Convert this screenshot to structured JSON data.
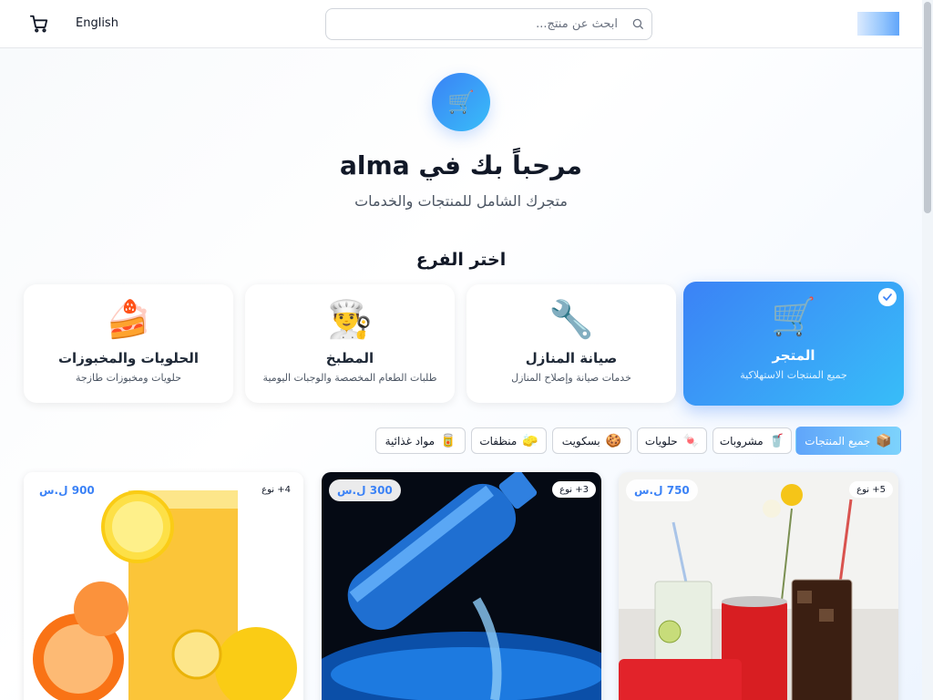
{
  "header": {
    "language_label": "English",
    "search_placeholder": "ابحث عن منتج...",
    "icons": {
      "cart": "cart-icon",
      "search": "search-icon"
    }
  },
  "hero": {
    "icon": "🛒",
    "title": "مرحباً بك في alma",
    "subtitle": "متجرك الشامل للمنتجات والخدمات"
  },
  "branches": {
    "title": "اختر الفرع",
    "items": [
      {
        "icon": "🛒",
        "name": "المتجر",
        "description": "جميع المنتجات الاستهلاكية",
        "selected": true
      },
      {
        "icon": "🔧",
        "name": "صيانة المنازل",
        "description": "خدمات صيانة وإصلاح المنازل",
        "selected": false
      },
      {
        "icon": "👨‍🍳",
        "name": "المطبخ",
        "description": "طلبات الطعام المخصصة والوجبات اليومية",
        "selected": false
      },
      {
        "icon": "🍰",
        "name": "الحلويات والمخبوزات",
        "description": "حلويات ومخبوزات طازجة",
        "selected": false
      }
    ]
  },
  "categories": [
    {
      "icon": "📦",
      "label": "جميع المنتجات",
      "active": true
    },
    {
      "icon": "🥤",
      "label": "مشروبات",
      "active": false
    },
    {
      "icon": "🍬",
      "label": "حلويات",
      "active": false
    },
    {
      "icon": "🍪",
      "label": "بسكويت",
      "active": false
    },
    {
      "icon": "🧽",
      "label": "منظفات",
      "active": false
    },
    {
      "icon": "🥫",
      "label": "مواد غذائية",
      "active": false
    }
  ],
  "products": [
    {
      "image": "soft-drinks-photo",
      "count_badge": "5+ نوع",
      "price": "750 ل.س"
    },
    {
      "image": "water-bottle-photo",
      "count_badge": "3+ نوع",
      "price": "300 ل.س"
    },
    {
      "image": "orange-juice-photo",
      "count_badge": "4+ نوع",
      "price": "900 ل.س"
    }
  ],
  "colors": {
    "accent": "#3b82f6",
    "accent_light": "#38bdf8"
  }
}
